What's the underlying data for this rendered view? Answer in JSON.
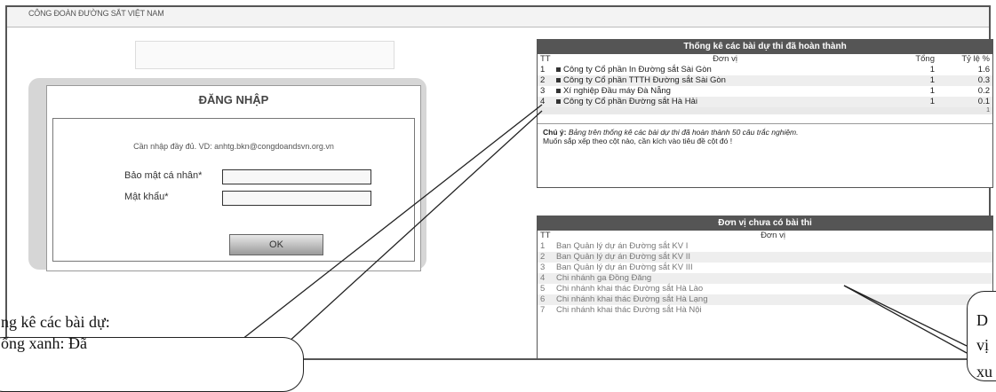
{
  "site_title": "CÔNG ĐOÀN ĐƯỜNG SẮT VIỆT NAM",
  "login": {
    "title": "ĐĂNG NHẬP",
    "hint": "Cần nhập đầy đủ. VD: anhtg.bkn@congdoandsvn.org.vn",
    "username_label": "Bảo mật cá nhân*",
    "password_label": "Mật khẩu*",
    "ok_label": "OK"
  },
  "stats": {
    "title": "Thống kê các bài dự thi đã hoàn thành",
    "headers": {
      "tt": "TT",
      "unit": "Đơn vị",
      "total": "Tổng",
      "ratio": "Tỷ lệ %"
    },
    "rows": [
      {
        "tt": "1",
        "unit": "Công ty Cổ phần In Đường sắt Sài Gòn",
        "total": "1",
        "ratio": "1.6"
      },
      {
        "tt": "2",
        "unit": "Công ty Cổ phần TTTH Đường sắt Sài Gòn",
        "total": "1",
        "ratio": "0.3"
      },
      {
        "tt": "3",
        "unit": "Xí nghiệp Đầu máy Đà Nẵng",
        "total": "1",
        "ratio": "0.2"
      },
      {
        "tt": "4",
        "unit": "Công ty Cổ phần Đường sắt Hà Hải",
        "total": "1",
        "ratio": "0.1"
      }
    ],
    "footer": "1",
    "note_label": "Chú ý:",
    "note_text": "Bảng trên thống kê các bài dự thi đã hoàn thành 50 câu trắc nghiệm.",
    "note_text2": "Muốn sắp xếp theo cột nào, cần kích vào tiêu đề cột đó !"
  },
  "missing": {
    "title": "Đơn vị chưa có bài thi",
    "headers": {
      "tt": "TT",
      "unit": "Đơn vị"
    },
    "rows": [
      {
        "tt": "1",
        "unit": "Ban Quản lý dự án Đường sắt KV I"
      },
      {
        "tt": "2",
        "unit": "Ban Quản lý dự án Đường sắt KV II"
      },
      {
        "tt": "3",
        "unit": "Ban Quản lý dự án Đường sắt KV III"
      },
      {
        "tt": "4",
        "unit": "Chi nhánh ga Đồng Đăng"
      },
      {
        "tt": "5",
        "unit": "Chi nhánh khai thác Đường sắt Hà Lào"
      },
      {
        "tt": "6",
        "unit": "Chi nhánh khai thác Đường sắt Hà Lạng"
      },
      {
        "tt": "7",
        "unit": "Chi nhánh khai thác Đường sắt Hà Nội"
      }
    ]
  },
  "callouts": {
    "left_line1": "ng kê các bài dự:",
    "left_line2": "ống xanh: Đã",
    "right_line1": "D",
    "right_line2": "vị",
    "right_line3": "xu"
  }
}
